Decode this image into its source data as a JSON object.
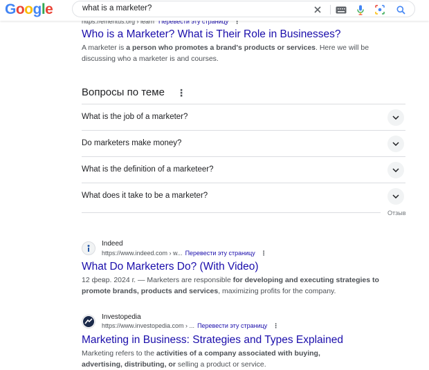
{
  "search": {
    "query": "what is a marketer?"
  },
  "brand": {
    "logo_letters": [
      "G",
      "o",
      "o",
      "g",
      "l",
      "e"
    ],
    "logo_colors": [
      "#4285F4",
      "#EA4335",
      "#FBBC05",
      "#4285F4",
      "#34A853",
      "#EA4335"
    ]
  },
  "result1": {
    "cite": "https://emeritus.org › learn",
    "translate": "Перевести эту страницу",
    "title": "Who is a Marketer? What is Their Role in Businesses?",
    "snippet_pre": "A marketer is ",
    "snippet_bold": "a person who promotes a brand's products or services",
    "snippet_post": ". Here we will be discussing who a marketer is and courses."
  },
  "paa": {
    "title": "Вопросы по теме",
    "questions": [
      "What is the job of a marketer?",
      "Do marketers make money?",
      "What is the definition of a marketeer?",
      "What does it take to be a marketer?"
    ],
    "feedback": "Отзыв"
  },
  "result2": {
    "site_name": "Indeed",
    "url": "https://www.indeed.com › w...",
    "translate": "Перевести эту страницу",
    "title": "What Do Marketers Do? (With Video)",
    "date": "12 февр. 2024 г. — ",
    "snippet_pre": "Marketers are responsible ",
    "snippet_bold": "for developing and executing strategies to promote brands, products and services",
    "snippet_post": ", maximizing profits for the company."
  },
  "result3": {
    "site_name": "Investopedia",
    "url": "https://www.investopedia.com › ...",
    "translate": "Перевести эту страницу",
    "title": "Marketing in Business: Strategies and Types Explained",
    "snippet_pre": "Marketing refers to the ",
    "snippet_bold1": "activities of a company associated with buying, advertising, distributing, or",
    "snippet_post": " selling a product or service."
  },
  "colors": {
    "link": "#1a0dab",
    "snippet": "#4d5156",
    "divider": "#dadce0"
  },
  "icons": [
    "clear-icon",
    "keyboard-icon",
    "microphone-icon",
    "lens-icon",
    "search-icon",
    "more-options-icon",
    "chevron-down-icon",
    "indeed-favicon",
    "investopedia-favicon"
  ]
}
